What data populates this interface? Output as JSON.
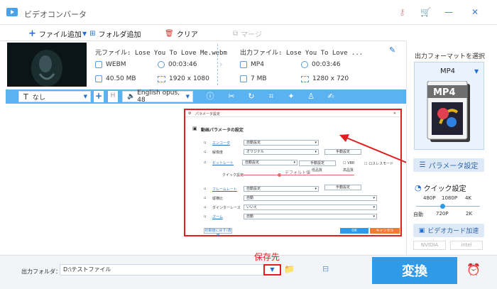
{
  "window": {
    "title": "ビデオコンバータ"
  },
  "toolbar": {
    "add_file": "ファイル追加",
    "add_folder": "フォルダ追加",
    "clear": "クリア",
    "merge": "マージ"
  },
  "source": {
    "filename": "元ファイル: Lose You To Love Me.webm",
    "format": "WEBM",
    "duration": "00:03:46",
    "size": "40.50 MB",
    "resolution": "1920 x 1080"
  },
  "output": {
    "filename": "出力ファイル: Lose You To Love ...",
    "format": "MP4",
    "duration": "00:03:46",
    "size": "7 MB",
    "resolution": "1280 x 720"
  },
  "editbar": {
    "subtitle": "なし",
    "audio": "English opus, 48"
  },
  "right_panel": {
    "select_format_label": "出力フォーマットを選択",
    "format_name": "MP4",
    "format_tile": "MP4",
    "param_button": "パラメータ設定",
    "quick_label": "クイック設定",
    "quick_top": [
      "480P",
      "1080P",
      "4K"
    ],
    "quick_bottom": [
      "自動",
      "720P",
      "2K"
    ],
    "gpu_button": "ビデオカード加速",
    "gpu_vendors": [
      "NVIDIA",
      "intel"
    ]
  },
  "dialog": {
    "title": "パラメータ設定",
    "section": "動画パラメータの設定",
    "rows": [
      {
        "label": "エンコーダ",
        "value": "自動設定"
      },
      {
        "label": "解像度",
        "value": "オリジナル"
      },
      {
        "label": "ビットレート",
        "value": "自動設定"
      },
      {
        "label": "フレームレート",
        "value": "自動設定"
      },
      {
        "label": "縦横比",
        "value": "自動"
      },
      {
        "label": "ダインターレース",
        "value": "いいえ"
      },
      {
        "label": "ズーム",
        "value": "自動"
      }
    ],
    "manual_label": "手動設定",
    "vbr_label": "VBR",
    "lossless_label": "ロスレスモード",
    "quick_label": "クイック設定",
    "quality_low": "低品質",
    "quality_default": "デフォルト値",
    "quality_high": "高品質",
    "reset_button": "初期値に戻す/適用",
    "ok_button": "OK",
    "cancel_button": "キャンセル"
  },
  "bottom": {
    "folder_label": "出力フォルダ：",
    "folder_path": "D:\\テストファイル",
    "annotation": "保存先",
    "convert": "変換"
  },
  "colors": {
    "accent": "#2f9be8",
    "editbar": "#5ab3f0",
    "highlight": "#e02020"
  }
}
